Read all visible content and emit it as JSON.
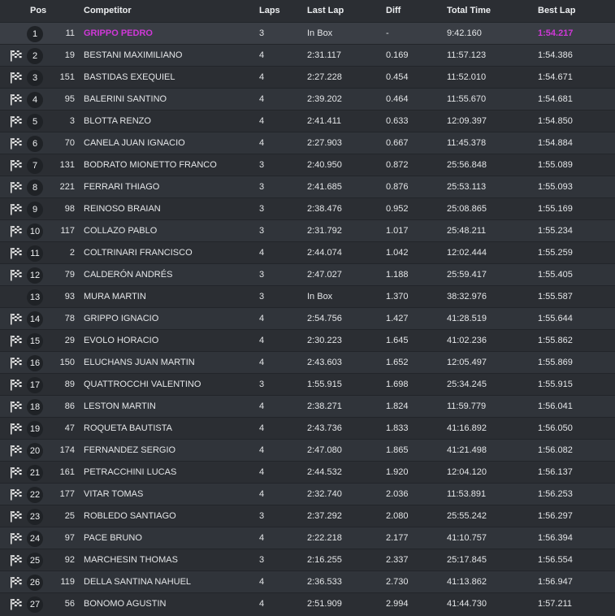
{
  "columns": {
    "pos": "Pos",
    "competitor": "Competitor",
    "laps": "Laps",
    "last_lap": "Last Lap",
    "diff": "Diff",
    "total_time": "Total Time",
    "best_lap": "Best Lap"
  },
  "colors": {
    "background": "#2b2e33",
    "highlight": "#d038d8"
  },
  "rows": [
    {
      "pos": "1",
      "num": "11",
      "name": "GRIPPO PEDRO",
      "laps": "3",
      "last": "In Box",
      "diff": "-",
      "total": "9:42.160",
      "best": "1:54.217",
      "flag": false,
      "highlight": true
    },
    {
      "pos": "2",
      "num": "19",
      "name": "BESTANI MAXIMILIANO",
      "laps": "4",
      "last": "2:31.117",
      "diff": "0.169",
      "total": "11:57.123",
      "best": "1:54.386",
      "flag": true
    },
    {
      "pos": "3",
      "num": "151",
      "name": "BASTIDAS EXEQUIEL",
      "laps": "4",
      "last": "2:27.228",
      "diff": "0.454",
      "total": "11:52.010",
      "best": "1:54.671",
      "flag": true
    },
    {
      "pos": "4",
      "num": "95",
      "name": "BALERINI SANTINO",
      "laps": "4",
      "last": "2:39.202",
      "diff": "0.464",
      "total": "11:55.670",
      "best": "1:54.681",
      "flag": true
    },
    {
      "pos": "5",
      "num": "3",
      "name": "BLOTTA RENZO",
      "laps": "4",
      "last": "2:41.411",
      "diff": "0.633",
      "total": "12:09.397",
      "best": "1:54.850",
      "flag": true
    },
    {
      "pos": "6",
      "num": "70",
      "name": "CANELA JUAN IGNACIO",
      "laps": "4",
      "last": "2:27.903",
      "diff": "0.667",
      "total": "11:45.378",
      "best": "1:54.884",
      "flag": true
    },
    {
      "pos": "7",
      "num": "131",
      "name": "BODRATO MIONETTO FRANCO",
      "laps": "3",
      "last": "2:40.950",
      "diff": "0.872",
      "total": "25:56.848",
      "best": "1:55.089",
      "flag": true
    },
    {
      "pos": "8",
      "num": "221",
      "name": "FERRARI THIAGO",
      "laps": "3",
      "last": "2:41.685",
      "diff": "0.876",
      "total": "25:53.113",
      "best": "1:55.093",
      "flag": true
    },
    {
      "pos": "9",
      "num": "98",
      "name": "REINOSO BRAIAN",
      "laps": "3",
      "last": "2:38.476",
      "diff": "0.952",
      "total": "25:08.865",
      "best": "1:55.169",
      "flag": true
    },
    {
      "pos": "10",
      "num": "117",
      "name": "COLLAZO PABLO",
      "laps": "3",
      "last": "2:31.792",
      "diff": "1.017",
      "total": "25:48.211",
      "best": "1:55.234",
      "flag": true
    },
    {
      "pos": "11",
      "num": "2",
      "name": "COLTRINARI FRANCISCO",
      "laps": "4",
      "last": "2:44.074",
      "diff": "1.042",
      "total": "12:02.444",
      "best": "1:55.259",
      "flag": true
    },
    {
      "pos": "12",
      "num": "79",
      "name": "CALDERÓN ANDRÉS",
      "laps": "3",
      "last": "2:47.027",
      "diff": "1.188",
      "total": "25:59.417",
      "best": "1:55.405",
      "flag": true
    },
    {
      "pos": "13",
      "num": "93",
      "name": "MURA MARTIN",
      "laps": "3",
      "last": "In Box",
      "diff": "1.370",
      "total": "38:32.976",
      "best": "1:55.587",
      "flag": false
    },
    {
      "pos": "14",
      "num": "78",
      "name": "GRIPPO IGNACIO",
      "laps": "4",
      "last": "2:54.756",
      "diff": "1.427",
      "total": "41:28.519",
      "best": "1:55.644",
      "flag": true
    },
    {
      "pos": "15",
      "num": "29",
      "name": "EVOLO HORACIO",
      "laps": "4",
      "last": "2:30.223",
      "diff": "1.645",
      "total": "41:02.236",
      "best": "1:55.862",
      "flag": true
    },
    {
      "pos": "16",
      "num": "150",
      "name": "ELUCHANS JUAN MARTIN",
      "laps": "4",
      "last": "2:43.603",
      "diff": "1.652",
      "total": "12:05.497",
      "best": "1:55.869",
      "flag": true
    },
    {
      "pos": "17",
      "num": "89",
      "name": "QUATTROCCHI VALENTINO",
      "laps": "3",
      "last": "1:55.915",
      "diff": "1.698",
      "total": "25:34.245",
      "best": "1:55.915",
      "flag": true
    },
    {
      "pos": "18",
      "num": "86",
      "name": "LESTON MARTIN",
      "laps": "4",
      "last": "2:38.271",
      "diff": "1.824",
      "total": "11:59.779",
      "best": "1:56.041",
      "flag": true
    },
    {
      "pos": "19",
      "num": "47",
      "name": "ROQUETA BAUTISTA",
      "laps": "4",
      "last": "2:43.736",
      "diff": "1.833",
      "total": "41:16.892",
      "best": "1:56.050",
      "flag": true
    },
    {
      "pos": "20",
      "num": "174",
      "name": "FERNANDEZ SERGIO",
      "laps": "4",
      "last": "2:47.080",
      "diff": "1.865",
      "total": "41:21.498",
      "best": "1:56.082",
      "flag": true
    },
    {
      "pos": "21",
      "num": "161",
      "name": "PETRACCHINI LUCAS",
      "laps": "4",
      "last": "2:44.532",
      "diff": "1.920",
      "total": "12:04.120",
      "best": "1:56.137",
      "flag": true
    },
    {
      "pos": "22",
      "num": "177",
      "name": "VITAR TOMAS",
      "laps": "4",
      "last": "2:32.740",
      "diff": "2.036",
      "total": "11:53.891",
      "best": "1:56.253",
      "flag": true
    },
    {
      "pos": "23",
      "num": "25",
      "name": "ROBLEDO SANTIAGO",
      "laps": "3",
      "last": "2:37.292",
      "diff": "2.080",
      "total": "25:55.242",
      "best": "1:56.297",
      "flag": true
    },
    {
      "pos": "24",
      "num": "97",
      "name": "PACE BRUNO",
      "laps": "4",
      "last": "2:22.218",
      "diff": "2.177",
      "total": "41:10.757",
      "best": "1:56.394",
      "flag": true
    },
    {
      "pos": "25",
      "num": "92",
      "name": "MARCHESIN THOMAS",
      "laps": "3",
      "last": "2:16.255",
      "diff": "2.337",
      "total": "25:17.845",
      "best": "1:56.554",
      "flag": true
    },
    {
      "pos": "26",
      "num": "119",
      "name": "DELLA SANTINA NAHUEL",
      "laps": "4",
      "last": "2:36.533",
      "diff": "2.730",
      "total": "41:13.862",
      "best": "1:56.947",
      "flag": true
    },
    {
      "pos": "27",
      "num": "56",
      "name": "BONOMO AGUSTIN",
      "laps": "4",
      "last": "2:51.909",
      "diff": "2.994",
      "total": "41:44.730",
      "best": "1:57.211",
      "flag": true
    }
  ]
}
